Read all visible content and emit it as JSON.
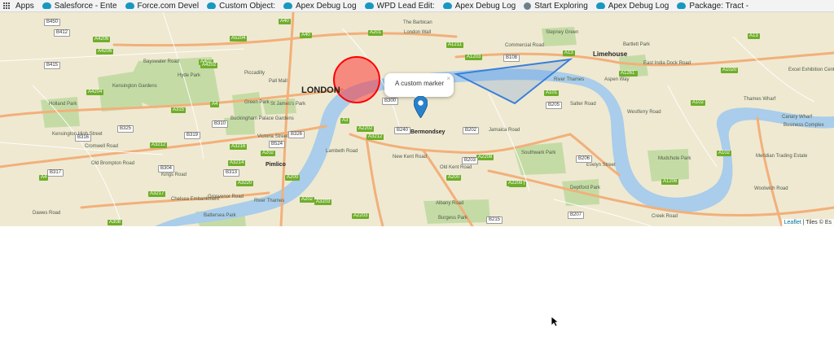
{
  "bookmarks": [
    {
      "label": "Apps",
      "icon": "apps-grid-icon"
    },
    {
      "label": "Salesforce - Ente",
      "icon": "salesforce-cloud-icon"
    },
    {
      "label": "Force.com Devel",
      "icon": "salesforce-cloud-icon"
    },
    {
      "label": "Custom Object:",
      "icon": "salesforce-cloud-icon"
    },
    {
      "label": "Apex Debug Log",
      "icon": "salesforce-cloud-icon"
    },
    {
      "label": "WPD Lead Edit:",
      "icon": "salesforce-cloud-icon"
    },
    {
      "label": "Apex Debug Log",
      "icon": "salesforce-cloud-icon"
    },
    {
      "label": "Start Exploring",
      "icon": "globe-icon"
    },
    {
      "label": "Apex Debug Log",
      "icon": "salesforce-cloud-icon"
    },
    {
      "label": "Package: Tract -",
      "icon": "salesforce-cloud-icon"
    }
  ],
  "map": {
    "popup_text": "A custom marker",
    "popup_close": "×",
    "attribution_link": "Leaflet",
    "attribution_rest": " | Tiles © Es",
    "colors": {
      "river": "#a9cdea",
      "land": "#efe9d2",
      "park": "#c5dba5",
      "circle": "#ff0000",
      "polygon": "#3a7fd9",
      "marker": "#2a81cb"
    },
    "places_major": [
      {
        "name": "LONDON"
      },
      {
        "name": "Limehouse"
      },
      {
        "name": "Bermondsey"
      },
      {
        "name": "Pimlico"
      }
    ],
    "places": [
      {
        "name": "Hyde Park"
      },
      {
        "name": "Kensington Gardens"
      },
      {
        "name": "Holland Park"
      },
      {
        "name": "Green Park"
      },
      {
        "name": "St James's Park"
      },
      {
        "name": "Buckingham Palace Gardens"
      },
      {
        "name": "Stepney Green"
      },
      {
        "name": "Bartlett Park"
      },
      {
        "name": "Excel Exhibition Centre"
      },
      {
        "name": "Thames Wharf"
      },
      {
        "name": "Canary Wharf"
      },
      {
        "name": "Business Complex"
      },
      {
        "name": "Southwark Park"
      },
      {
        "name": "Deptford Park"
      },
      {
        "name": "Mudchute Park"
      },
      {
        "name": "Meridian Trading Estate"
      },
      {
        "name": "Battersea Park"
      },
      {
        "name": "Burgess Park"
      },
      {
        "name": "River Thames"
      },
      {
        "name": "River Thames"
      },
      {
        "name": "The Barbican"
      },
      {
        "name": "London Wall"
      },
      {
        "name": "Kensington High Street"
      },
      {
        "name": "Cromwell Road"
      },
      {
        "name": "Old Brompton Road"
      },
      {
        "name": "Kings Road"
      },
      {
        "name": "Chelsea Embankment"
      },
      {
        "name": "Grosvenor Road"
      },
      {
        "name": "Dawes Road"
      },
      {
        "name": "Commercial Road"
      },
      {
        "name": "East India Dock Road"
      },
      {
        "name": "Jamaica Road"
      },
      {
        "name": "Albany Road"
      },
      {
        "name": "Old Kent Road"
      },
      {
        "name": "Evelyn Street"
      },
      {
        "name": "Creek Road"
      },
      {
        "name": "Woolwich Road"
      },
      {
        "name": "Lambeth Road"
      },
      {
        "name": "New Kent Road"
      },
      {
        "name": "Pall Mall"
      },
      {
        "name": "Piccadilly"
      },
      {
        "name": "Bayswater Road"
      },
      {
        "name": "Victoria Street"
      },
      {
        "name": "Salter Road"
      },
      {
        "name": "Westferry Road"
      },
      {
        "name": "Aspen Way"
      }
    ],
    "roads": [
      {
        "label": "A40",
        "type": "a"
      },
      {
        "label": "A4206",
        "type": "a"
      },
      {
        "label": "A4206",
        "type": "a"
      },
      {
        "label": "A5204",
        "type": "a"
      },
      {
        "label": "A40",
        "type": "a"
      },
      {
        "label": "A201",
        "type": "a"
      },
      {
        "label": "A1211",
        "type": "a"
      },
      {
        "label": "A13",
        "type": "a"
      },
      {
        "label": "A1203",
        "type": "a"
      },
      {
        "label": "A13",
        "type": "a"
      },
      {
        "label": "A402",
        "type": "a"
      },
      {
        "label": "A4202",
        "type": "a"
      },
      {
        "label": "A1203",
        "type": "a"
      },
      {
        "label": "A1020",
        "type": "a"
      },
      {
        "label": "A4204",
        "type": "a"
      },
      {
        "label": "A4",
        "type": "a"
      },
      {
        "label": "A315",
        "type": "a"
      },
      {
        "label": "A4",
        "type": "a"
      },
      {
        "label": "A3212",
        "type": "a"
      },
      {
        "label": "A3216",
        "type": "a"
      },
      {
        "label": "A202",
        "type": "a"
      },
      {
        "label": "A3214",
        "type": "a"
      },
      {
        "label": "A3220",
        "type": "a"
      },
      {
        "label": "A3217",
        "type": "a"
      },
      {
        "label": "A200",
        "type": "a"
      },
      {
        "label": "A2202",
        "type": "a"
      },
      {
        "label": "A202",
        "type": "a"
      },
      {
        "label": "A2208",
        "type": "a"
      },
      {
        "label": "A200",
        "type": "a"
      },
      {
        "label": "A1206",
        "type": "a"
      },
      {
        "label": "A1203",
        "type": "a"
      },
      {
        "label": "A102",
        "type": "a"
      },
      {
        "label": "A101",
        "type": "a"
      },
      {
        "label": "A3",
        "type": "a"
      },
      {
        "label": "A3212",
        "type": "a"
      },
      {
        "label": "A308",
        "type": "a"
      },
      {
        "label": "A3203",
        "type": "a"
      },
      {
        "label": "A2203",
        "type": "a"
      },
      {
        "label": "A2208",
        "type": "a"
      },
      {
        "label": "A1261",
        "type": "a"
      },
      {
        "label": "A102",
        "type": "a"
      },
      {
        "label": "B450",
        "type": "b"
      },
      {
        "label": "B412",
        "type": "b"
      },
      {
        "label": "B415",
        "type": "b"
      },
      {
        "label": "B325",
        "type": "b"
      },
      {
        "label": "B316",
        "type": "b"
      },
      {
        "label": "B319",
        "type": "b"
      },
      {
        "label": "B310",
        "type": "b"
      },
      {
        "label": "B304",
        "type": "b"
      },
      {
        "label": "B313",
        "type": "b"
      },
      {
        "label": "B317",
        "type": "b"
      },
      {
        "label": "B300",
        "type": "b"
      },
      {
        "label": "B240",
        "type": "b"
      },
      {
        "label": "B202",
        "type": "b"
      },
      {
        "label": "B205",
        "type": "b"
      },
      {
        "label": "B206",
        "type": "b"
      },
      {
        "label": "B207",
        "type": "b"
      },
      {
        "label": "B215",
        "type": "b"
      },
      {
        "label": "B203",
        "type": "b"
      },
      {
        "label": "B108",
        "type": "b"
      },
      {
        "label": "B326",
        "type": "b"
      },
      {
        "label": "B524",
        "type": "b"
      }
    ]
  }
}
